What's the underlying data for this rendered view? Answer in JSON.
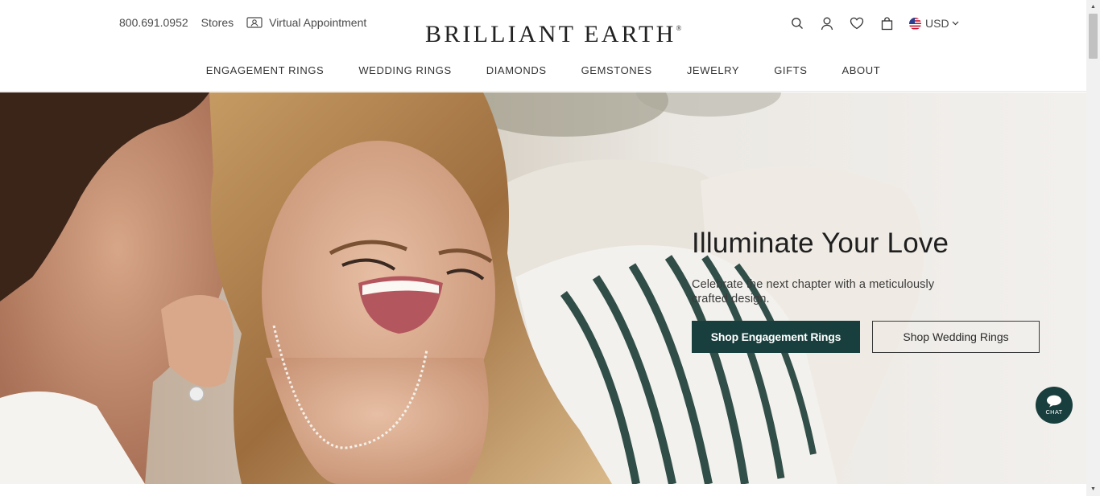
{
  "header": {
    "phone": "800.691.0952",
    "stores_label": "Stores",
    "virtual_appointment_label": "Virtual Appointment",
    "logo_text": "BRILLIANT EARTH",
    "logo_mark": "®",
    "currency": "USD"
  },
  "nav": {
    "items": [
      "ENGAGEMENT RINGS",
      "WEDDING RINGS",
      "DIAMONDS",
      "GEMSTONES",
      "JEWELRY",
      "GIFTS",
      "ABOUT"
    ]
  },
  "hero": {
    "title": "Illuminate Your Love",
    "subtitle": "Celebrate the next chapter with a meticulously crafted design.",
    "primary_button": "Shop Engagement Rings",
    "secondary_button": "Shop Wedding Rings"
  },
  "chat": {
    "label": "CHAT"
  },
  "colors": {
    "brand_green": "#183f3d",
    "text_dark": "#1f1f1f"
  },
  "icons": [
    "search-icon",
    "account-icon",
    "heart-icon",
    "bag-icon",
    "us-flag-icon",
    "chevron-down-icon",
    "virtual-appointment-icon",
    "chat-bubble-icon"
  ]
}
